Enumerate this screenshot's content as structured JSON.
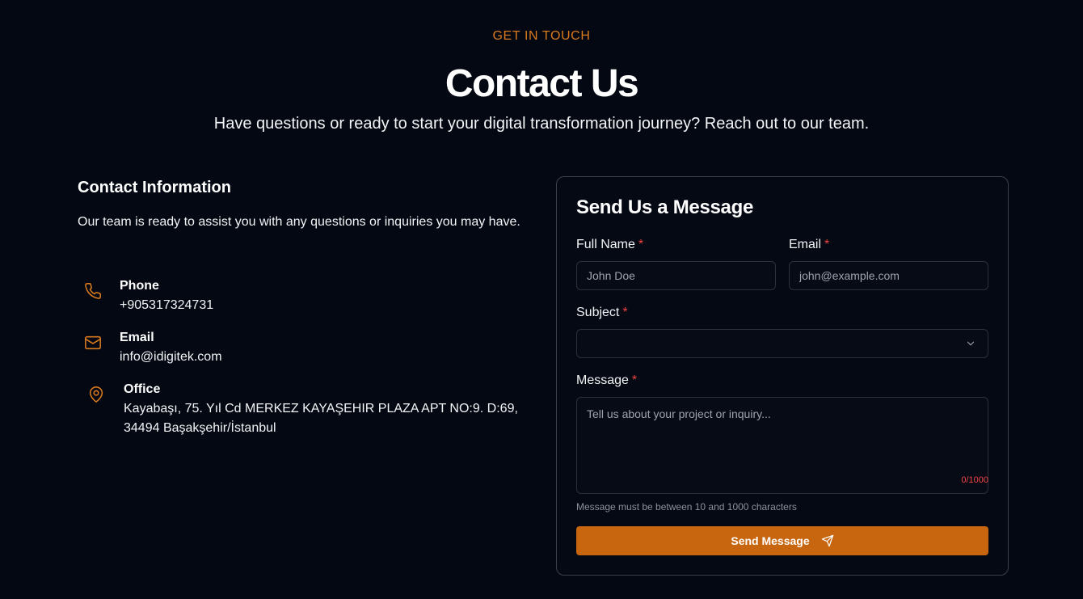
{
  "header": {
    "eyebrow": "GET IN TOUCH",
    "title": "Contact Us",
    "subtitle": "Have questions or ready to start your digital transformation journey? Reach out to our team."
  },
  "contact_info": {
    "title": "Contact Information",
    "description": "Our team is ready to assist you with any questions or inquiries you may have.",
    "items": [
      {
        "icon": "phone-icon",
        "label": "Phone",
        "value": "+905317324731"
      },
      {
        "icon": "mail-icon",
        "label": "Email",
        "value": "info@idigitek.com"
      },
      {
        "icon": "map-pin-icon",
        "label": "Office",
        "value_line1": "Kayabaşı, 75. Yıl Cd MERKEZ KAYAŞEHIR PLAZA APT NO:9. D:69,",
        "value_line2": "34494 Başakşehir/İstanbul"
      }
    ]
  },
  "form": {
    "title": "Send Us a Message",
    "required_mark": "*",
    "full_name": {
      "label": "Full Name",
      "placeholder": "John Doe"
    },
    "email": {
      "label": "Email",
      "placeholder": "john@example.com"
    },
    "subject": {
      "label": "Subject",
      "value": ""
    },
    "message": {
      "label": "Message",
      "placeholder": "Tell us about your project or inquiry...",
      "counter": "0/1000",
      "hint": "Message must be between 10 and 1000 characters"
    },
    "submit_label": "Send Message"
  },
  "colors": {
    "background": "#040813",
    "accent": "#d97a1f",
    "button": "#c8650f",
    "required": "#ef4444"
  }
}
